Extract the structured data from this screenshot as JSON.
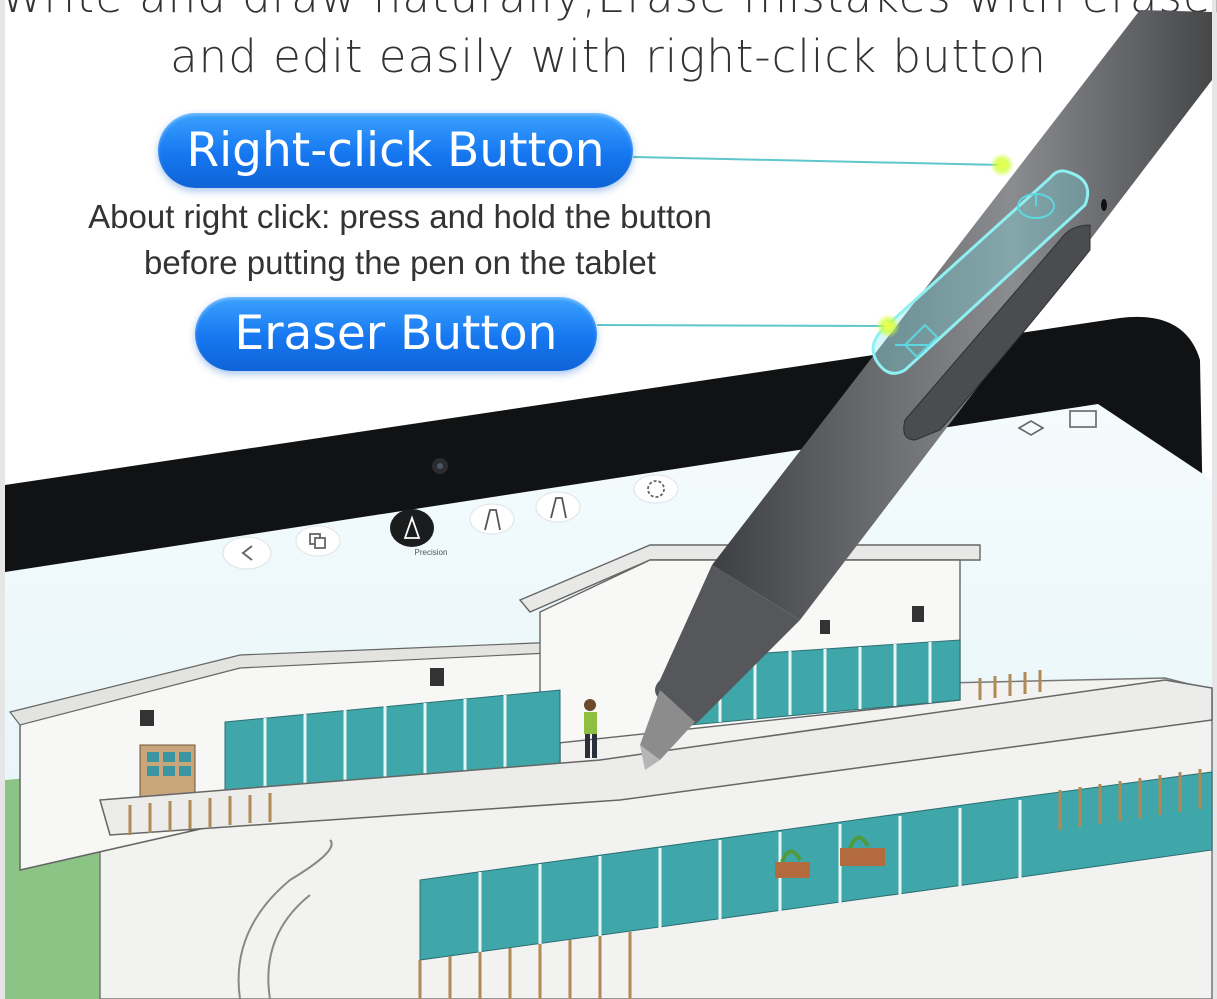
{
  "headline": {
    "line1": "Write and draw naturally,Erase mistakes with eraser",
    "line2": "and edit easily with right-click button"
  },
  "callouts": {
    "right_click": {
      "label": "Right-click Button",
      "note_line1": "About right click: press and hold the button",
      "note_line2": "before putting the pen on the tablet"
    },
    "eraser": {
      "label": "Eraser Button"
    }
  },
  "tablet_toolbar": {
    "active_tool_label": "Precision"
  },
  "icons": [
    "back-icon",
    "layers-icon",
    "precision-pen-icon",
    "marker-icon",
    "brush-icon",
    "lasso-icon",
    "mouse-icon",
    "eraser-icon"
  ],
  "colors": {
    "pill_blue": "#1677f0",
    "leader_line": "#4fc3c8",
    "leader_dot": "#d8ff3a",
    "pen_body": "#5f6164",
    "grass": "#7ab87a",
    "glass": "#3aa6a8"
  }
}
